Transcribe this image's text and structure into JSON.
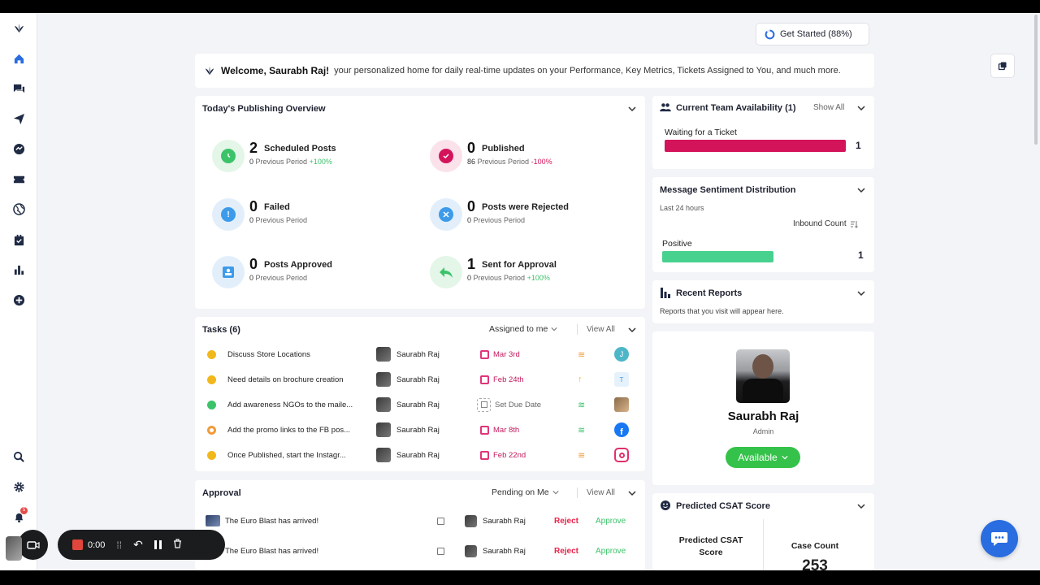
{
  "header": {
    "get_started_label": "Get Started (88%)"
  },
  "welcome": {
    "name": "Welcome, Saurabh Raj!",
    "message": "your personalized home for daily real-time updates on your Performance, Key Metrics, Tickets Assigned to You, and much more."
  },
  "publishing": {
    "title": "Today's Publishing Overview",
    "items": [
      {
        "count": "2",
        "label": "Scheduled Posts",
        "prev": "0",
        "prev_label": "Previous Period",
        "change": "+100%"
      },
      {
        "count": "0",
        "label": "Published",
        "prev": "86",
        "prev_label": "Previous Period",
        "change": "-100%"
      },
      {
        "count": "0",
        "label": "Failed",
        "prev": "0",
        "prev_label": "Previous Period",
        "change": ""
      },
      {
        "count": "0",
        "label": "Posts were Rejected",
        "prev": "0",
        "prev_label": "Previous Period",
        "change": ""
      },
      {
        "count": "0",
        "label": "Posts Approved",
        "prev": "0",
        "prev_label": "Previous Period",
        "change": ""
      },
      {
        "count": "1",
        "label": "Sent for Approval",
        "prev": "0",
        "prev_label": "Previous Period",
        "change": "+100%"
      }
    ]
  },
  "tasks": {
    "title": "Tasks (6)",
    "filter": "Assigned to me",
    "view_all": "View All",
    "rows": [
      {
        "title": "Discuss Store Locations",
        "assignee": "Saurabh Raj",
        "due": "Mar 3rd"
      },
      {
        "title": "Need details on brochure creation",
        "assignee": "Saurabh Raj",
        "due": "Feb 24th"
      },
      {
        "title": "Add awareness NGOs to the maile...",
        "assignee": "Saurabh Raj",
        "due": "Set Due Date"
      },
      {
        "title": "Add the promo links to the FB pos...",
        "assignee": "Saurabh Raj",
        "due": "Mar 8th"
      },
      {
        "title": "Once Published, start the Instagr...",
        "assignee": "Saurabh Raj",
        "due": "Feb 22nd"
      }
    ]
  },
  "approval": {
    "title": "Approval",
    "filter": "Pending on Me",
    "view_all": "View All",
    "rows": [
      {
        "title": "The Euro Blast has arrived!",
        "assignee": "Saurabh Raj",
        "reject": "Reject",
        "approve": "Approve"
      },
      {
        "title": "The Euro Blast has arrived!",
        "assignee": "Saurabh Raj",
        "reject": "Reject",
        "approve": "Approve"
      }
    ]
  },
  "team": {
    "title": "Current Team Availability (1)",
    "show_all": "Show All",
    "status_label": "Waiting for a Ticket",
    "status_count": "1",
    "bar_fraction": 1.0
  },
  "sentiment": {
    "title": "Message Sentiment Distribution",
    "period": "Last 24 hours",
    "sort_label": "Inbound Count",
    "label": "Positive",
    "count": "1"
  },
  "reports": {
    "title": "Recent Reports",
    "empty": "Reports that you visit will appear here."
  },
  "profile": {
    "name": "Saurabh Raj",
    "role": "Admin",
    "availability": "Available"
  },
  "csat": {
    "title": "Predicted CSAT Score",
    "score_label": "Predicted CSAT Score",
    "case_count_label": "Case Count",
    "case_count": "253"
  },
  "recorder": {
    "time": "0:00"
  },
  "sidebar": {
    "notification_count": "5"
  },
  "colors": {
    "accent": "#2a6de0",
    "pink": "#d4145a",
    "green": "#3cc36a"
  }
}
